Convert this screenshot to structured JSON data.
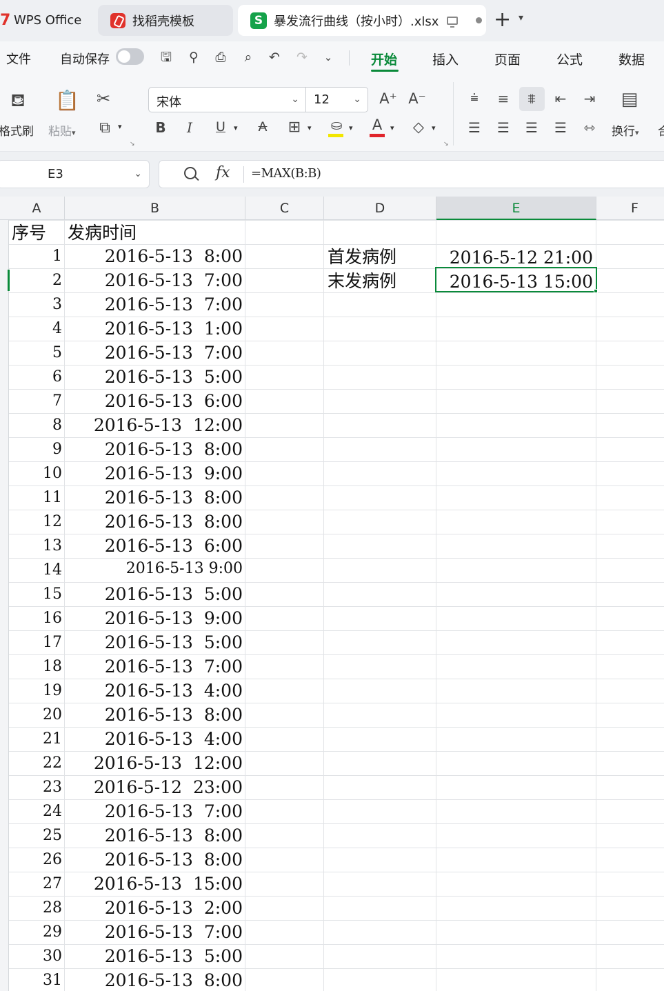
{
  "titlebar": {
    "tabs": [
      {
        "label": "WPS Office",
        "icon": "wps-logo-icon"
      },
      {
        "label": "找稻壳模板",
        "icon": "docer-logo-icon"
      },
      {
        "label": "暴发流行曲线（按小时）.xlsx",
        "icon": "spreadsheet-s-icon"
      }
    ],
    "new_tab_glyph": "+",
    "tab_list_glyph": "⌄"
  },
  "menubar": {
    "file_label": "文件",
    "autosave_label": "自动保存",
    "ribbon_tabs": [
      "开始",
      "插入",
      "页面",
      "公式",
      "数据"
    ],
    "active_tab": "开始"
  },
  "ribbon": {
    "format_painter_label": "格式刷",
    "paste_label": "粘贴",
    "font_name": "宋体",
    "font_size": "12",
    "wrap_label": "换行",
    "right_cut_label": "合",
    "accent_color": "#0a8a3a",
    "highlight_color": "#f2e600",
    "font_color": "#e0242b"
  },
  "formula_bar": {
    "name_box": "E3",
    "fx_glyph": "fx",
    "formula": "=MAX(B:B)"
  },
  "sheet": {
    "columns": [
      "A",
      "B",
      "C",
      "D",
      "E",
      "F"
    ],
    "selected_column": "E",
    "header_row": {
      "a": "序号",
      "b": "发病时间"
    },
    "labels": {
      "d2": "首发病例",
      "d3": "末发病例"
    },
    "values": {
      "e2": "2016-5-12 21:00",
      "e3": "2016-5-13 15:00"
    },
    "rows": [
      {
        "n": "1",
        "t": "2016-5-13  8:00"
      },
      {
        "n": "2",
        "t": "2016-5-13  7:00"
      },
      {
        "n": "3",
        "t": "2016-5-13  7:00"
      },
      {
        "n": "4",
        "t": "2016-5-13  1:00"
      },
      {
        "n": "5",
        "t": "2016-5-13  7:00"
      },
      {
        "n": "6",
        "t": "2016-5-13  5:00"
      },
      {
        "n": "7",
        "t": "2016-5-13  6:00"
      },
      {
        "n": "8",
        "t": "2016-5-13  12:00"
      },
      {
        "n": "9",
        "t": "2016-5-13  8:00"
      },
      {
        "n": "10",
        "t": "2016-5-13  9:00"
      },
      {
        "n": "11",
        "t": "2016-5-13  8:00"
      },
      {
        "n": "12",
        "t": "2016-5-13  8:00"
      },
      {
        "n": "13",
        "t": "2016-5-13  6:00"
      },
      {
        "n": "14",
        "t": "2016-5-13 9:00"
      },
      {
        "n": "15",
        "t": "2016-5-13  5:00"
      },
      {
        "n": "16",
        "t": "2016-5-13  9:00"
      },
      {
        "n": "17",
        "t": "2016-5-13  5:00"
      },
      {
        "n": "18",
        "t": "2016-5-13  7:00"
      },
      {
        "n": "19",
        "t": "2016-5-13  4:00"
      },
      {
        "n": "20",
        "t": "2016-5-13  8:00"
      },
      {
        "n": "21",
        "t": "2016-5-13  4:00"
      },
      {
        "n": "22",
        "t": "2016-5-13  12:00"
      },
      {
        "n": "23",
        "t": "2016-5-12  23:00"
      },
      {
        "n": "24",
        "t": "2016-5-13  7:00"
      },
      {
        "n": "25",
        "t": "2016-5-13  8:00"
      },
      {
        "n": "26",
        "t": "2016-5-13  8:00"
      },
      {
        "n": "27",
        "t": "2016-5-13  15:00"
      },
      {
        "n": "28",
        "t": "2016-5-13  2:00"
      },
      {
        "n": "29",
        "t": "2016-5-13  7:00"
      },
      {
        "n": "30",
        "t": "2016-5-13  5:00"
      },
      {
        "n": "31",
        "t": "2016-5-13  8:00"
      }
    ]
  }
}
